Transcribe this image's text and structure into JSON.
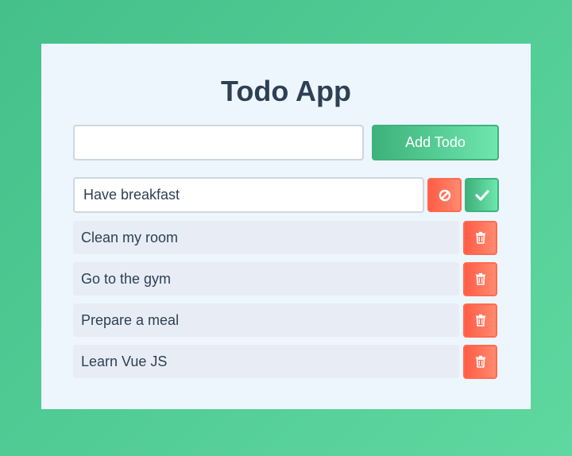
{
  "app": {
    "title": "Todo App"
  },
  "add_form": {
    "input_value": "",
    "input_placeholder": "",
    "button_label": "Add Todo"
  },
  "editing": {
    "value": "Have breakfast",
    "cancel_icon": "cancel-icon",
    "confirm_icon": "check-icon"
  },
  "todos": [
    {
      "text": "Clean my room",
      "action_icon": "trash-icon"
    },
    {
      "text": "Go to the gym",
      "action_icon": "trash-icon"
    },
    {
      "text": "Prepare a meal",
      "action_icon": "trash-icon"
    },
    {
      "text": "Learn Vue JS",
      "action_icon": "trash-icon"
    }
  ],
  "colors": {
    "background": "#4cc98f",
    "card": "#eef6fd",
    "title": "#2d4055",
    "accent_green": "#3db27b",
    "accent_red": "#ff5c45",
    "item_bg": "#e8edf5"
  }
}
